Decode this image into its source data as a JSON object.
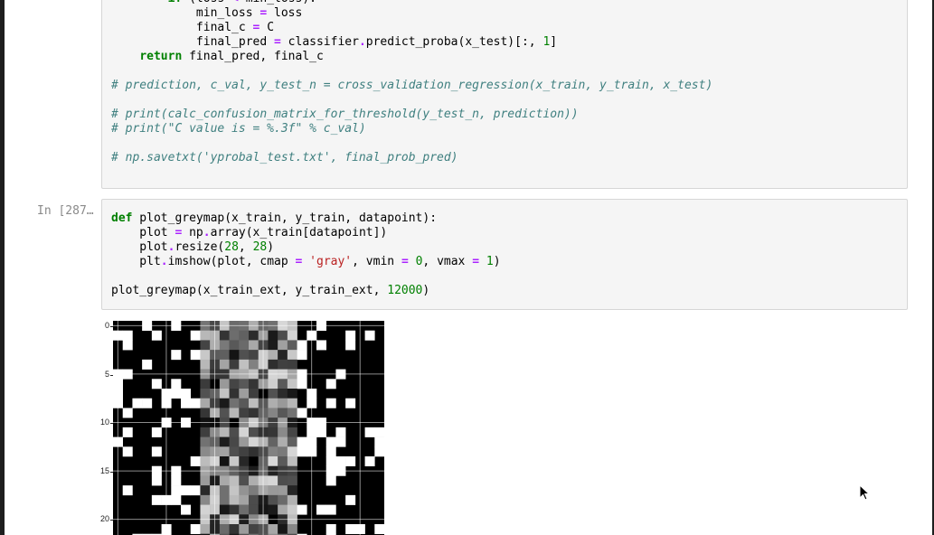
{
  "cells": [
    {
      "prompt": "",
      "lines": [
        [
          [
            "",
            "        "
          ],
          [
            "kw",
            "if"
          ],
          [
            "",
            " (loss "
          ],
          [
            "op",
            "<"
          ],
          [
            "",
            " min_loss):"
          ]
        ],
        [
          [
            "",
            "            min_loss "
          ],
          [
            "op",
            "="
          ],
          [
            "",
            " loss"
          ]
        ],
        [
          [
            "",
            "            final_c "
          ],
          [
            "op",
            "="
          ],
          [
            "",
            " C"
          ]
        ],
        [
          [
            "",
            "            final_pred "
          ],
          [
            "op",
            "="
          ],
          [
            "",
            " classifier"
          ],
          [
            "op",
            "."
          ],
          [
            "",
            "predict_proba(x_test)[:, "
          ],
          [
            "num",
            "1"
          ],
          [
            "",
            "]"
          ]
        ],
        [
          [
            "",
            "    "
          ],
          [
            "kw",
            "return"
          ],
          [
            "",
            " final_pred, final_c"
          ]
        ],
        [],
        [
          [
            "cm",
            "# prediction, c_val, y_test_n = cross_validation_regression(x_train, y_train, x_test)"
          ]
        ],
        [],
        [
          [
            "cm",
            "# print(calc_confusion_matrix_for_threshold(y_test_n, prediction))"
          ]
        ],
        [
          [
            "cm",
            "# print(\"C value is = %.3f\" % c_val)"
          ]
        ],
        [],
        [
          [
            "cm",
            "# np.savetxt('yprobal_test.txt', final_prob_pred)"
          ]
        ]
      ]
    },
    {
      "prompt": "In [287…",
      "lines": [
        [
          [
            "kw",
            "def"
          ],
          [
            "",
            " plot_greymap(x_train, y_train, datapoint):"
          ]
        ],
        [
          [
            "",
            "    plot "
          ],
          [
            "op",
            "="
          ],
          [
            "",
            " np"
          ],
          [
            "op",
            "."
          ],
          [
            "",
            "array(x_train[datapoint])"
          ]
        ],
        [
          [
            "",
            "    plot"
          ],
          [
            "op",
            "."
          ],
          [
            "",
            "resize("
          ],
          [
            "num",
            "28"
          ],
          [
            "",
            ", "
          ],
          [
            "num",
            "28"
          ],
          [
            "",
            ")"
          ]
        ],
        [
          [
            "",
            "    plt"
          ],
          [
            "op",
            "."
          ],
          [
            "",
            "imshow(plot, cmap "
          ],
          [
            "op",
            "="
          ],
          [
            "",
            " "
          ],
          [
            "str",
            "'gray'"
          ],
          [
            "",
            ", vmin "
          ],
          [
            "op",
            "="
          ],
          [
            "",
            " "
          ],
          [
            "num",
            "0"
          ],
          [
            "",
            ", vmax "
          ],
          [
            "op",
            "="
          ],
          [
            "",
            " "
          ],
          [
            "num",
            "1"
          ],
          [
            "",
            ")"
          ]
        ],
        [],
        [
          [
            "",
            "plot_greymap(x_train_ext, y_train_ext, "
          ],
          [
            "num",
            "12000"
          ],
          [
            "",
            ")"
          ]
        ]
      ]
    }
  ],
  "output_plot": {
    "y_ticks": [
      "0",
      "5",
      "10",
      "15",
      "20"
    ],
    "colormap": "gray",
    "vmin": 0,
    "vmax": 1
  }
}
